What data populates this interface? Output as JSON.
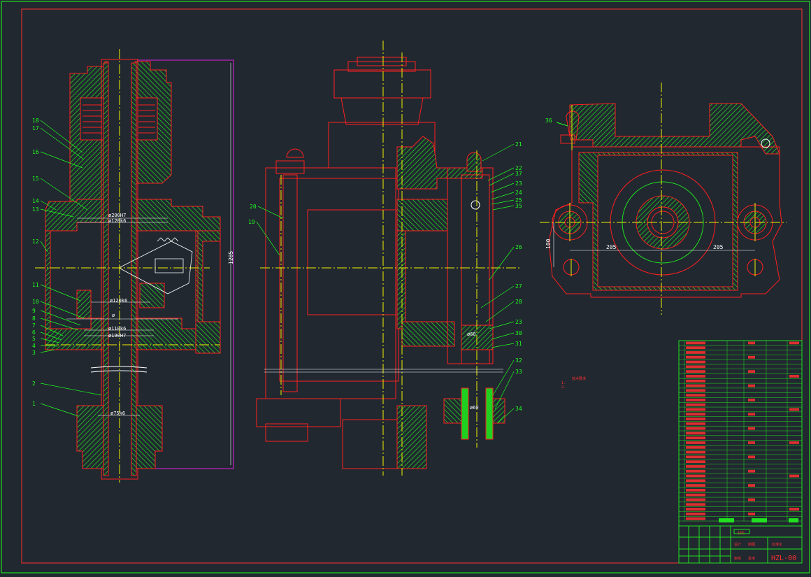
{
  "colors": {
    "background": "#212830",
    "outline": "#ff2020",
    "hatch": "#20d020",
    "centerline": "#f0f000",
    "leader": "#20ff20",
    "dimension": "#ffffff",
    "frame_outer": "#20e020",
    "frame_inner": "#ff3030",
    "magenta": "#e020e0"
  },
  "drawing": {
    "drawing_number": "HZL-00",
    "left_view": {
      "overall_height_dim": "1285",
      "fit_labels": [
        "ø200H7",
        "ø120k6",
        "ø120k6",
        "ø110k6",
        "ø190H7",
        "ø75k6",
        "ø"
      ],
      "balloons": [
        "18",
        "17",
        "16",
        "15",
        "14",
        "13",
        "12",
        "11",
        "10",
        "9",
        "8",
        "7",
        "6",
        "5",
        "4",
        "3",
        "2",
        "1"
      ]
    },
    "middle_view": {
      "fit_labels": [
        "ø60",
        "ø60"
      ],
      "balloons": [
        "20",
        "19",
        "21",
        "22",
        "37",
        "23",
        "24",
        "25",
        "35",
        "26",
        "27",
        "28",
        "23",
        "30",
        "31",
        "32",
        "33",
        "34"
      ]
    },
    "right_view": {
      "balloon": "36",
      "dimensions": [
        "100",
        "205",
        "205"
      ]
    },
    "tech_note_lines": [
      "技术要求",
      "1.",
      "2."
    ],
    "title_block": {
      "parts_rows": 38,
      "cells": [
        "材料",
        "设计",
        "制图",
        "审核",
        "标准化",
        "批准"
      ]
    }
  }
}
